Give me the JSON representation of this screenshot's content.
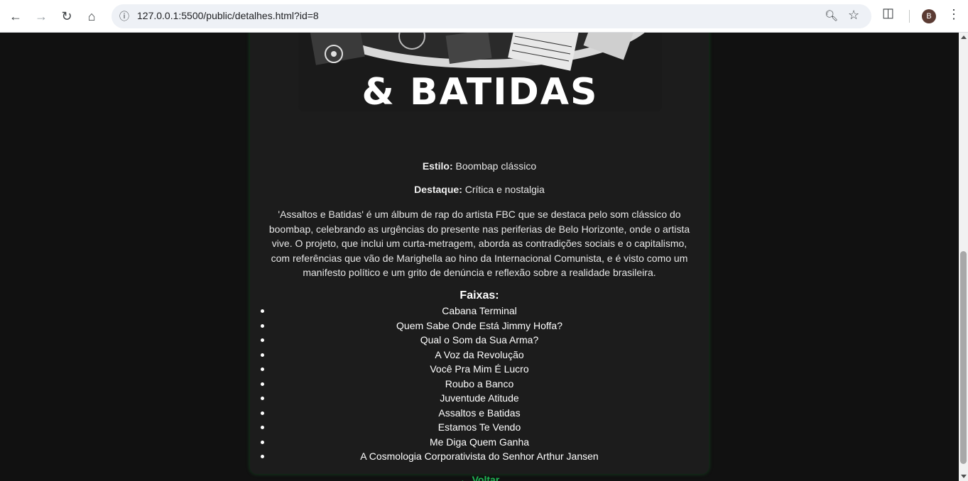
{
  "browser": {
    "url": "127.0.0.1:5500/public/detalhes.html?id=8",
    "profile_initial": "B"
  },
  "album": {
    "cover_text": "& BATIDAS",
    "style_label": "Estilo:",
    "style_value": "Boombap clássico",
    "highlight_label": "Destaque:",
    "highlight_value": "Crítica e nostalgia",
    "description": "'Assaltos e Batidas' é um álbum de rap do artista FBC que se destaca pelo som clássico do boombap, celebrando as urgências do presente nas periferias de Belo Horizonte, onde o artista vive. O projeto, que inclui um curta-metragem, aborda as contradições sociais e o capitalismo, com referências que vão de Marighella ao hino da Internacional Comunista, e é visto como um manifesto político e um grito de denúncia e reflexão sobre a realidade brasileira.",
    "tracks_title": "Faixas:",
    "tracks": [
      "Cabana Terminal",
      "Quem Sabe Onde Está Jimmy Hoffa?",
      "Qual o Som da Sua Arma?",
      "A Voz da Revolução",
      "Você Pra Mim É Lucro",
      "Roubo a Banco",
      "Juventude Atitude",
      "Assaltos e Batidas",
      "Estamos Te Vendo",
      "Me Diga Quem Ganha",
      "A Cosmologia Corporativista do Senhor Arthur Jansen"
    ],
    "back_link": "← Voltar"
  },
  "colors": {
    "page_bg": "#111111",
    "card_bg": "#1c1c1c",
    "accent": "#1db954"
  }
}
